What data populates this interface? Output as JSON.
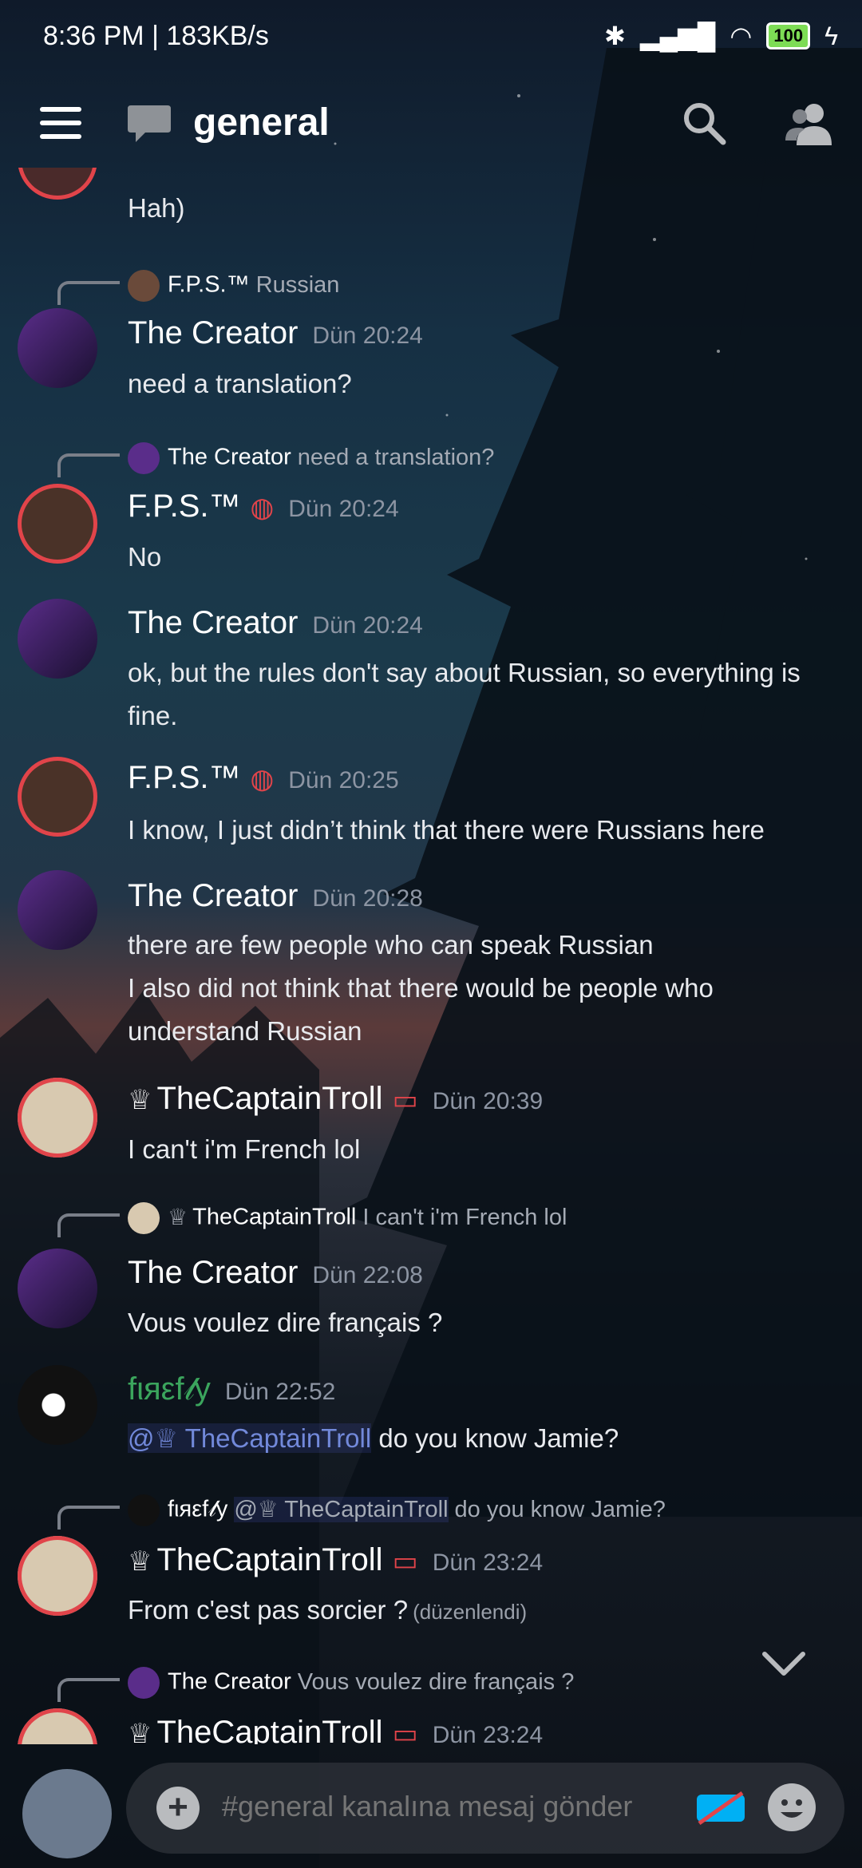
{
  "status": {
    "time": "8:36 PM | 183KB/s",
    "battery": "100"
  },
  "header": {
    "channel": "general"
  },
  "messages": [
    {
      "text": "Hah)"
    },
    {
      "reply_name": "F.P.S.™",
      "reply_text": "Russian",
      "name": "The Creator",
      "time": "Dün 20:24",
      "text": "need a translation?"
    },
    {
      "reply_name": "The Creator",
      "reply_text": "need a translation?",
      "name": "F.P.S.™",
      "time": "Dün 20:24",
      "text": "No"
    },
    {
      "name": "The Creator",
      "time": "Dün 20:24",
      "text": "ok, but the rules don't say about Russian, so everything is fine."
    },
    {
      "name": "F.P.S.™",
      "time": "Dün 20:25",
      "text": "I know, I just didn’t think that there were Russians here"
    },
    {
      "name": "The Creator",
      "time": "Dün 20:28",
      "text1": "there are few people who can speak Russian",
      "text2": "I also did not think that there would be people who understand Russian"
    },
    {
      "name": "TheCaptainTroll",
      "time": "Dün 20:39",
      "text": "I can't i'm French lol"
    },
    {
      "reply_name": "TheCaptainTroll",
      "reply_text": "I can't i'm French lol",
      "name": "The Creator",
      "time": "Dün 22:08",
      "text": "Vous voulez dire français ?"
    },
    {
      "name": "fιяεf𝓁y",
      "time": "Dün 22:52",
      "mention": "@♕ TheCaptainTroll",
      "text": " do you know Jamie?"
    },
    {
      "reply_name": "fιяεf𝓁y",
      "reply_mention": "@♕ TheCaptainTroll",
      "reply_text": "do you know Jamie?",
      "name": "TheCaptainTroll",
      "time": "Dün 23:24",
      "text": "From c'est pas sorcier ?",
      "edited": "(düzenlendi)"
    },
    {
      "reply_name": "The Creator",
      "reply_text": "Vous voulez dire français ?",
      "name": "TheCaptainTroll",
      "time": "Dün 23:24"
    }
  ],
  "composer": {
    "placeholder": "#general kanalına mesaj gönder"
  },
  "colors": {
    "accent_red": "#e1444a",
    "mention": "#7289da",
    "firefly_green": "#3ba55d"
  }
}
